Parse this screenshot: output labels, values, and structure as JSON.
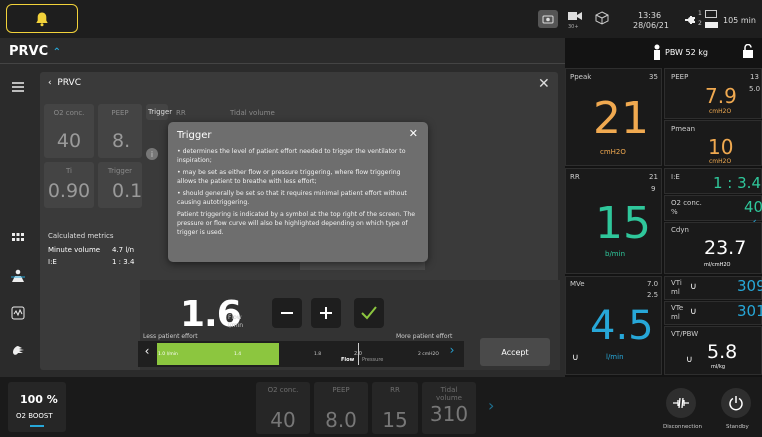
{
  "top": {
    "time": "13:36",
    "date": "28/06/21",
    "battery_1": "1",
    "battery_2": "2",
    "battery_time": "105 min",
    "sub_label": "30+"
  },
  "mode": {
    "label": "PRVC",
    "ppbw": "PBW 52 kg"
  },
  "panel": {
    "back_label": "PRVC",
    "params": [
      {
        "label": "O2 conc.",
        "value": "40"
      },
      {
        "label": "PEEP",
        "value": "8."
      },
      {
        "label": "RR",
        "value": ""
      },
      {
        "label": "Tidal volume",
        "value": ""
      }
    ],
    "params2": [
      {
        "label": "Ti",
        "value": "0.90"
      },
      {
        "label": "Trigger",
        "value": "0.1"
      }
    ],
    "trigger_tab": "Trigger",
    "calc_title": "Calculated metrics",
    "minute_volume_label": "Minute volume",
    "minute_volume_value": "4.7 l/n",
    "ie_label": "I:E",
    "ie_value": "1 : 3.4",
    "flow_value": "1.6",
    "flow_unit_1": "Flow",
    "flow_unit_2": "l/min",
    "less_effort": "Less patient effort",
    "more_effort": "More patient effort",
    "slider_ticks": [
      "1.0 l/min",
      "1.4",
      "1.8",
      "2.0",
      "2 cmH2O"
    ],
    "slider_flow": "Flow",
    "slider_pressure": "Pressure",
    "accept": "Accept"
  },
  "tooltip": {
    "title": "Trigger",
    "bullet1": "• determines the level of patient effort needed to trigger the ventilator to inspiration;",
    "bullet2": "• may be set as either flow or pressure triggering, where flow triggering allows the patient to breathe with less effort;",
    "bullet3": "• should generally be set so that it requires minimal patient effort without causing autotriggering.",
    "para": "Patient triggering is indicated by a symbol at the top right of the screen. The pressure or flow curve will also be highlighted depending on which type of trigger is used."
  },
  "monitor": {
    "ppeak_label": "Ppeak",
    "ppeak_top": "35",
    "ppeak_value": "21",
    "ppeak_unit": "cmH2O",
    "peep_label": "PEEP",
    "peep_top": "13",
    "peep_sub": "5.0",
    "peep_value": "7.9",
    "peep_unit": "cmH2O",
    "pmean_label": "Pmean",
    "pmean_value": "10",
    "pmean_unit": "cmH2O",
    "rr_label": "RR",
    "rr_top": "21",
    "rr_sub": "9",
    "rr_value": "15",
    "rr_unit": "b/min",
    "ie_label": "I:E",
    "ie_value": "1 : 3.4",
    "o2_label": "O2 conc.",
    "o2_unit": "%",
    "o2_value": "40",
    "cdyn_label": "Cdyn",
    "cdyn_value": "23.7",
    "cdyn_unit": "ml/cmH2O",
    "mve_label": "MVe",
    "mve_top": "7.0",
    "mve_sub": "2.5",
    "mve_value": "4.5",
    "mve_unit": "l/min",
    "vti_label": "VTi",
    "vti_unit": "ml",
    "vti_value": "309",
    "vte_label": "VTe",
    "vte_unit": "ml",
    "vte_value": "301",
    "vtpbw_label": "VT/PBW",
    "vtpbw_value": "5.8",
    "vtpbw_unit": "ml/kg"
  },
  "bottom": {
    "boost_value": "100 %",
    "boost_label": "O2 BOOST",
    "params": [
      {
        "label": "O2 conc.",
        "value": "40"
      },
      {
        "label": "PEEP",
        "value": "8.0"
      },
      {
        "label": "RR",
        "value": "15"
      },
      {
        "label": "Tidal volume",
        "value": "310"
      }
    ],
    "disconnection": "Disconnection",
    "standby": "Standby"
  },
  "colors": {
    "yellow": "#f2d23a",
    "orange": "#f0a950",
    "green": "#2fc79b",
    "blue": "#27a7d8",
    "accent": "#8cc63f"
  }
}
